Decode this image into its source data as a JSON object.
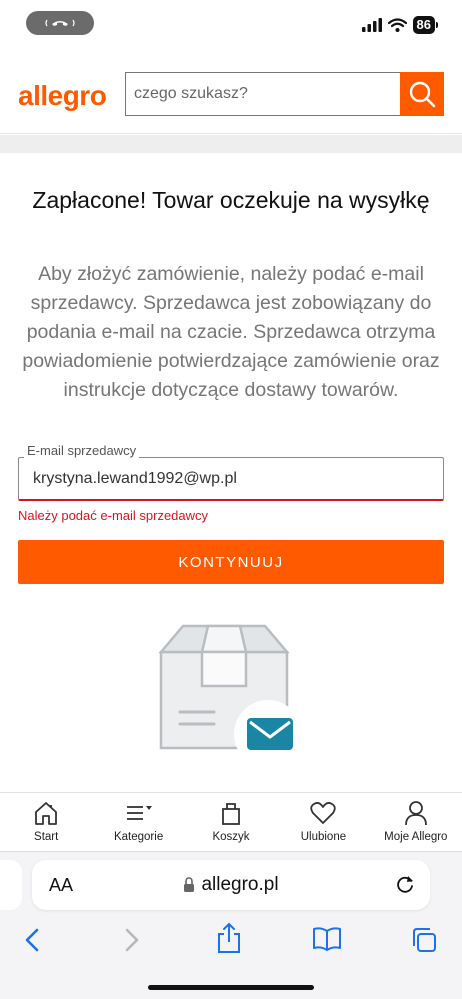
{
  "status_bar": {
    "battery": "86"
  },
  "header": {
    "logo": "allegro",
    "search_placeholder": "czego szukasz?"
  },
  "main": {
    "title": "Zapłacone! Towar oczekuje na wysyłkę",
    "description": "Aby złożyć zamówienie, należy podać e-mail sprzedawcy. Sprzedawca jest zobowiązany do podania e-mail na czacie. Sprzedawca otrzyma powiadomienie potwierdzające zamówienie oraz instrukcje dotyczące dostawy towarów.",
    "email_field": {
      "label": "E-mail sprzedawcy",
      "value": "krystyna.lewand1992@wp.pl",
      "error": "Należy podać e-mail sprzedawcy"
    },
    "continue_button": "KONTYNUUJ"
  },
  "bottom_nav": {
    "items": [
      {
        "label": "Start",
        "icon": "home-icon"
      },
      {
        "label": "Kategorie",
        "icon": "menu-icon"
      },
      {
        "label": "Koszyk",
        "icon": "bag-icon"
      },
      {
        "label": "Ulubione",
        "icon": "heart-icon"
      },
      {
        "label": "Moje Allegro",
        "icon": "user-icon"
      }
    ]
  },
  "browser": {
    "text_size_label": "AA",
    "url": "allegro.pl"
  },
  "colors": {
    "brand": "#ff5a00",
    "error": "#d4161c",
    "envelope": "#1a86a3"
  }
}
